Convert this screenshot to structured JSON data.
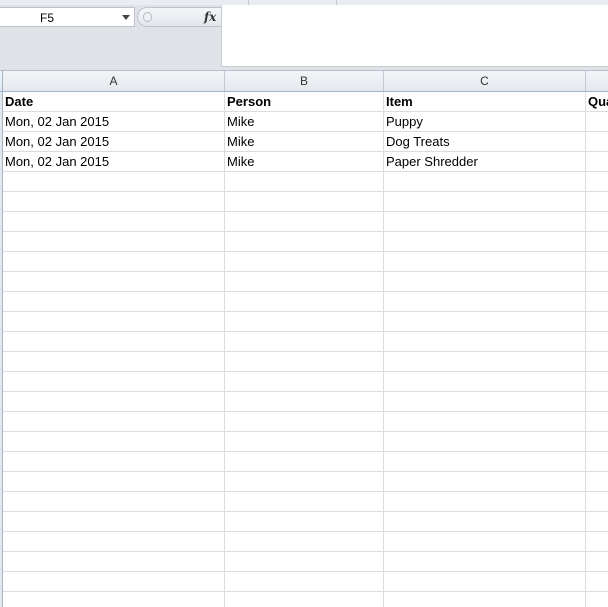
{
  "formula_bar": {
    "name_box": "F5",
    "fx_label": "fx",
    "formula": ""
  },
  "columns": [
    {
      "letter": "A"
    },
    {
      "letter": "B"
    },
    {
      "letter": "C"
    },
    {
      "letter": ""
    }
  ],
  "rows": [
    {
      "cells": [
        "Date",
        "Person",
        "Item",
        "Qua"
      ],
      "header": true
    },
    {
      "cells": [
        "Mon, 02 Jan 2015",
        "Mike",
        "Puppy",
        ""
      ]
    },
    {
      "cells": [
        "Mon, 02 Jan 2015",
        "Mike",
        "Dog Treats",
        ""
      ]
    },
    {
      "cells": [
        "Mon, 02 Jan 2015",
        "Mike",
        "Paper Shredder",
        ""
      ]
    }
  ],
  "empty_row_count": 22,
  "colors": {
    "gridline": "#dadcdd",
    "header_border": "#9eb6ce",
    "chrome": "#dfe3e8"
  }
}
